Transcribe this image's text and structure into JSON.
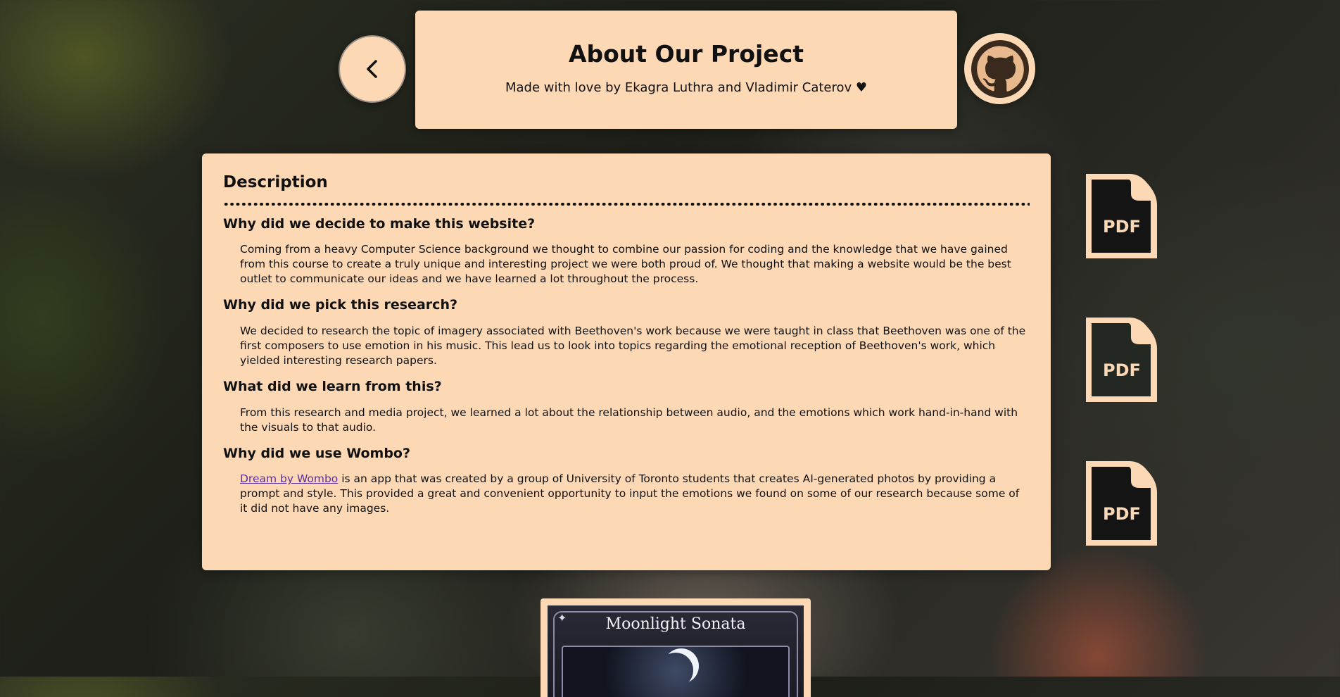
{
  "header": {
    "title": "About Our Project",
    "subtitle": "Made with love by Ekagra Luthra and Vladimir Caterov ♥"
  },
  "nav": {
    "back_icon": "chevron-left-icon",
    "github_icon": "github-icon"
  },
  "main": {
    "heading": "Description",
    "qa": [
      {
        "question": "Why did we decide to make this website?",
        "answer": "Coming from a heavy Computer Science background we thought to combine our passion for coding and the knowledge that we have gained from this course to create a truly unique and interesting project we were both proud of. We thought that making a website would be the best outlet to communicate our ideas and we have learned a lot throughout the process."
      },
      {
        "question": "Why did we pick this research?",
        "answer": "We decided to research the topic of imagery associated with Beethoven's work because we were taught in class that Beethoven was one of the first composers to use emotion in his music. This lead us to look into topics regarding the emotional reception of Beethoven's work, which yielded interesting research papers."
      },
      {
        "question": "What did we learn from this?",
        "answer": "From this research and media project, we learned a lot about the relationship between audio, and the emotions which work hand-in-hand with the visuals to that audio."
      },
      {
        "question": "Why did we use Wombo?",
        "link_text": "Dream by Wombo",
        "answer": " is an app that was created by a group of University of Toronto students that creates AI-generated photos by providing a prompt and style. This provided a great and convenient opportunity to input the emotions we found on some of our research because some of it did not have any images."
      }
    ]
  },
  "pdf_links": [
    {
      "label": "PDF"
    },
    {
      "label": "PDF"
    },
    {
      "label": "PDF"
    }
  ],
  "preview": {
    "title": "Moonlight Sonata"
  },
  "colors": {
    "card": "#fdd8b5",
    "text": "#111111",
    "link": "#5b2fa3"
  }
}
